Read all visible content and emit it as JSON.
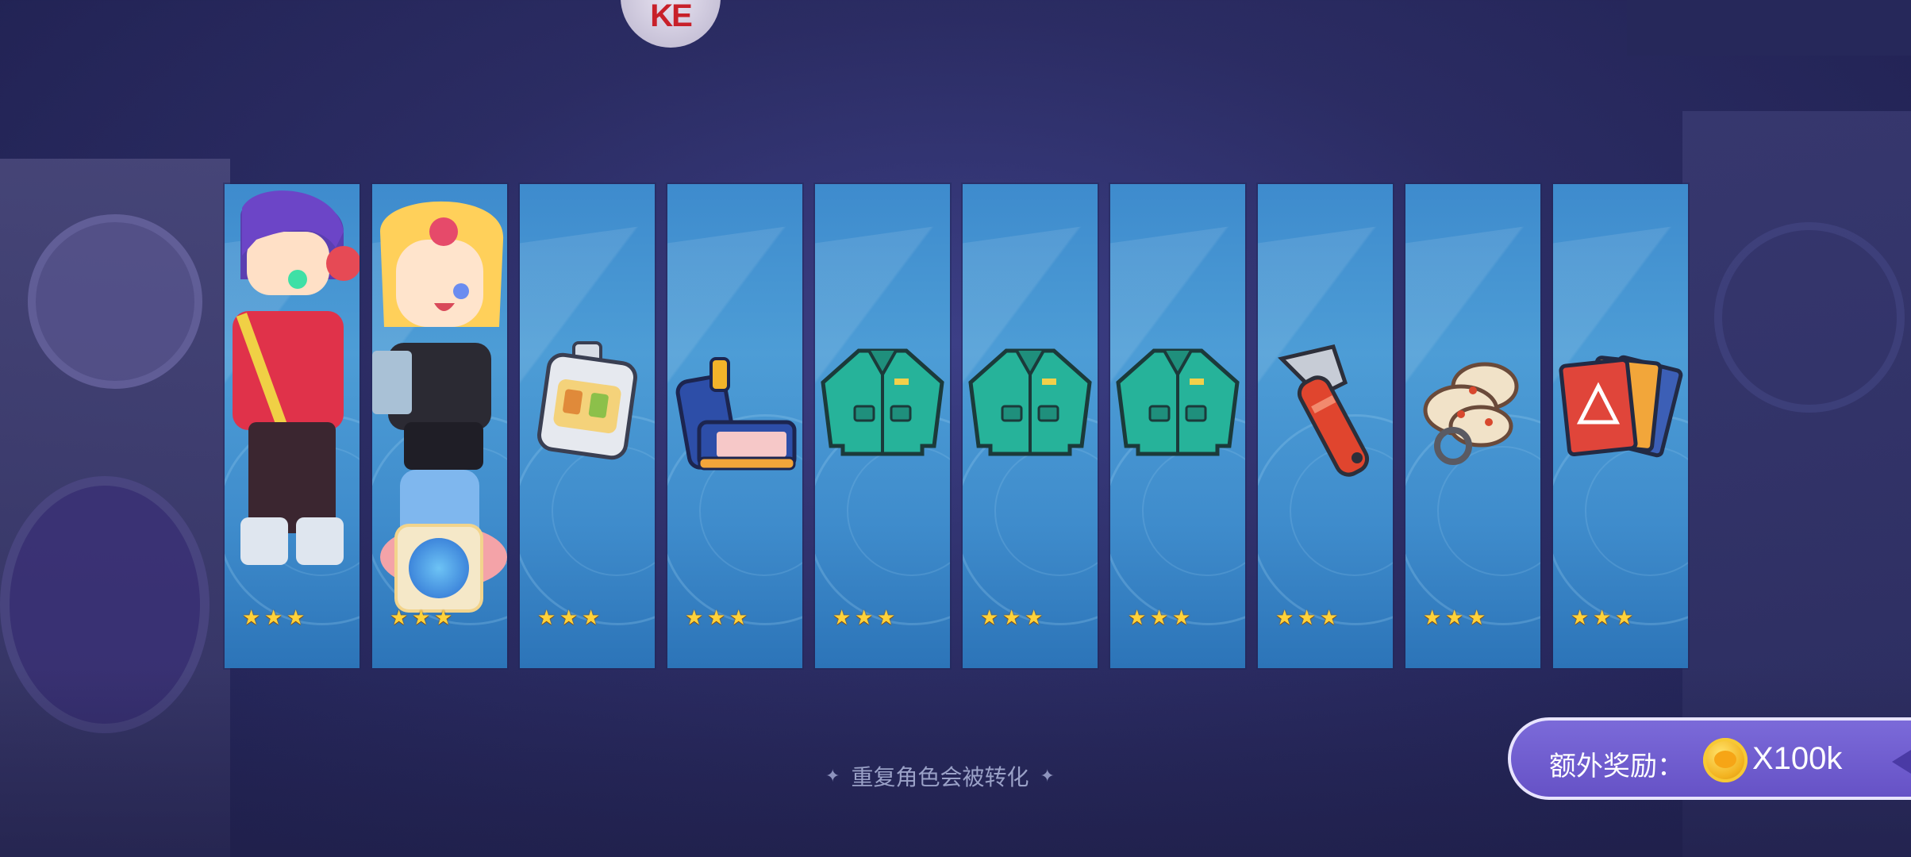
{
  "logo": {
    "text": "KE"
  },
  "cards": [
    {
      "name": "character-purple-hair",
      "stars": "★★★"
    },
    {
      "name": "character-blonde-girl",
      "stars": "★★★"
    },
    {
      "name": "item-flask",
      "stars": "★★★"
    },
    {
      "name": "item-staple-gun",
      "stars": "★★★"
    },
    {
      "name": "item-green-jacket",
      "stars": "★★★"
    },
    {
      "name": "item-green-jacket",
      "stars": "★★★"
    },
    {
      "name": "item-green-jacket",
      "stars": "★★★"
    },
    {
      "name": "item-wrench",
      "stars": "★★★"
    },
    {
      "name": "item-rope",
      "stars": "★★★"
    },
    {
      "name": "item-cards",
      "stars": "★★★"
    }
  ],
  "hint": {
    "text": "重复角色会被转化",
    "left_icon": "diamond-icon",
    "right_icon": "diamond-icon"
  },
  "bonus": {
    "label": "额外奖励：",
    "value": "X100k",
    "coin_icon": "gold-coin-icon",
    "arrow_icon": "collapse-arrow-icon"
  },
  "colors": {
    "card_blue": "#3f8ccc",
    "bonus_purple": "#6652c6",
    "star": "#ffd23a",
    "logo_red": "#c8202a"
  }
}
